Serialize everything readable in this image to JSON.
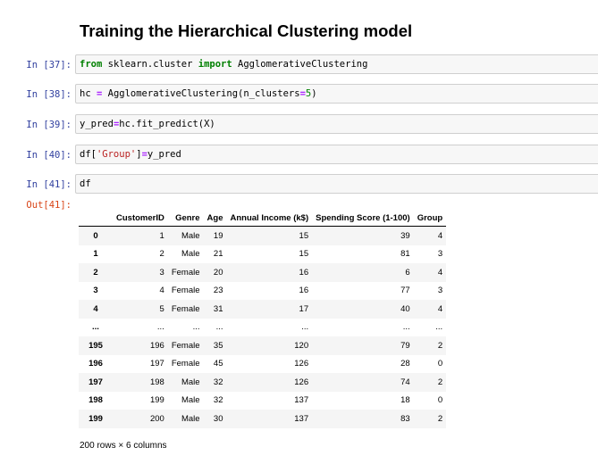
{
  "heading": "Training the Hierarchical Clustering model",
  "cells": [
    {
      "prompt": "In [37]:",
      "parts": [
        [
          "kw",
          "from"
        ],
        [
          "t",
          " sklearn.cluster "
        ],
        [
          "kw",
          "import"
        ],
        [
          "t",
          " AgglomerativeClustering"
        ]
      ]
    },
    {
      "prompt": "In [38]:",
      "parts": [
        [
          "t",
          "hc "
        ],
        [
          "op",
          "="
        ],
        [
          "t",
          " AgglomerativeClustering(n_clusters"
        ],
        [
          "op",
          "="
        ],
        [
          "num",
          "5"
        ],
        [
          "t",
          ")"
        ]
      ]
    },
    {
      "prompt": "In [39]:",
      "parts": [
        [
          "t",
          "y_pred"
        ],
        [
          "op",
          "="
        ],
        [
          "t",
          "hc.fit_predict(X)"
        ]
      ]
    },
    {
      "prompt": "In [40]:",
      "parts": [
        [
          "t",
          "df["
        ],
        [
          "str",
          "'Group'"
        ],
        [
          "t",
          "]"
        ],
        [
          "op",
          "="
        ],
        [
          "t",
          "y_pred"
        ]
      ]
    },
    {
      "prompt": "In [41]:",
      "parts": [
        [
          "t",
          "df"
        ]
      ]
    }
  ],
  "out_prompt": "Out[41]:",
  "table": {
    "columns": [
      "",
      "CustomerID",
      "Genre",
      "Age",
      "Annual Income (k$)",
      "Spending Score (1-100)",
      "Group"
    ],
    "rows": [
      [
        "0",
        "1",
        "Male",
        "19",
        "15",
        "39",
        "4"
      ],
      [
        "1",
        "2",
        "Male",
        "21",
        "15",
        "81",
        "3"
      ],
      [
        "2",
        "3",
        "Female",
        "20",
        "16",
        "6",
        "4"
      ],
      [
        "3",
        "4",
        "Female",
        "23",
        "16",
        "77",
        "3"
      ],
      [
        "4",
        "5",
        "Female",
        "31",
        "17",
        "40",
        "4"
      ],
      [
        "...",
        "...",
        "...",
        "...",
        "...",
        "...",
        "..."
      ],
      [
        "195",
        "196",
        "Female",
        "35",
        "120",
        "79",
        "2"
      ],
      [
        "196",
        "197",
        "Female",
        "45",
        "126",
        "28",
        "0"
      ],
      [
        "197",
        "198",
        "Male",
        "32",
        "126",
        "74",
        "2"
      ],
      [
        "198",
        "199",
        "Male",
        "32",
        "137",
        "18",
        "0"
      ],
      [
        "199",
        "200",
        "Male",
        "30",
        "137",
        "83",
        "2"
      ]
    ]
  },
  "summary": "200 rows × 6 columns"
}
